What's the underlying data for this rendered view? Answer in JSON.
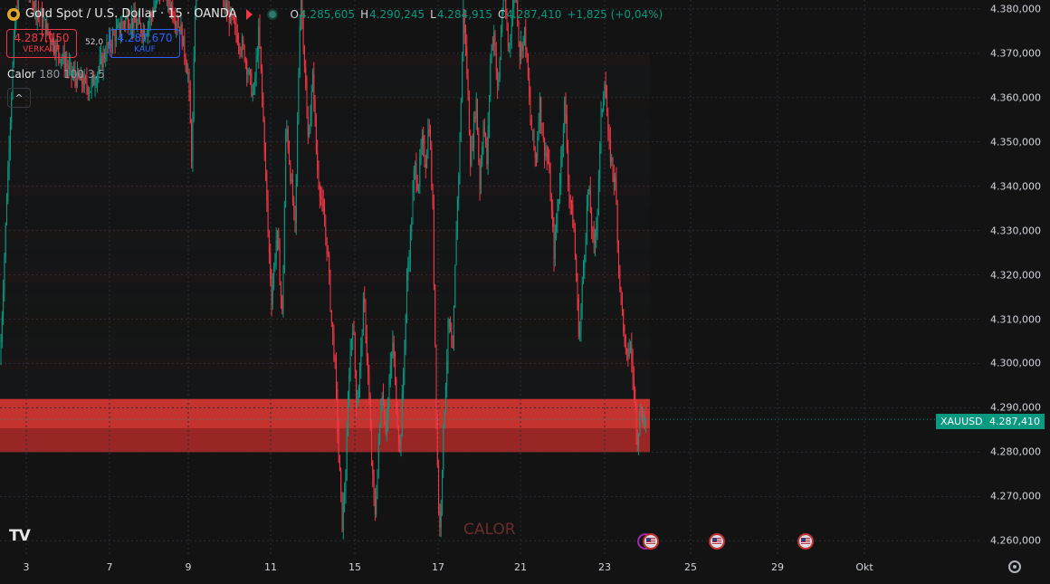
{
  "header": {
    "symbol_title": "Gold Spot / U.S. Dollar · 15 · OANDA",
    "ohlc": {
      "o_label": "O",
      "o_value": "4.285,605",
      "h_label": "H",
      "h_value": "4.290,245",
      "l_label": "L",
      "l_value": "4.284,915",
      "c_label": "C",
      "c_value": "4.287,410",
      "change": "+1,825 (+0,04%)"
    }
  },
  "trade": {
    "bid_price": "4.287,150",
    "bid_label": "VERKAUF",
    "spread": "52,0",
    "ask_price": "4.287,670",
    "ask_label": "KAUF"
  },
  "indicator": {
    "name": "Calor",
    "params": "180 100 3,5",
    "collapse_glyph": "^"
  },
  "watermark": "CALOR",
  "logo_text": "TV",
  "price_tag": {
    "symbol": "XAUUSD",
    "price": "4.287,410"
  },
  "colors": {
    "up": "#089981",
    "down": "#f23645",
    "zone": "#e53935",
    "background": "#131313"
  },
  "icons": [
    "gold-coin-icon",
    "flag-icon",
    "market-status-dot-icon",
    "chevron-up-icon",
    "us-flag-event-icon",
    "settings-gear-icon"
  ],
  "chart_data": {
    "type": "candlestick",
    "symbol": "XAUUSD",
    "y_ticks": [
      "4.260,000",
      "4.270,000",
      "4.280,000",
      "4.290,000",
      "4.300,000",
      "4.310,000",
      "4.320,000",
      "4.330,000",
      "4.340,000",
      "4.350,000",
      "4.360,000",
      "4.370,000",
      "4.380,000"
    ],
    "x_ticks": [
      "3",
      "7",
      "9",
      "11",
      "15",
      "17",
      "21",
      "23",
      "25",
      "29",
      "Okt"
    ],
    "ylim": [
      4257,
      4382
    ],
    "last_price": 4287.41,
    "zone": {
      "from": 4280,
      "to": 4292
    },
    "grid": true,
    "path": [
      [
        0,
        4300
      ],
      [
        6,
        4330
      ],
      [
        10,
        4350
      ],
      [
        16,
        4375
      ],
      [
        24,
        4390
      ],
      [
        40,
        4380
      ],
      [
        60,
        4372
      ],
      [
        80,
        4365
      ],
      [
        100,
        4362
      ],
      [
        120,
        4372
      ],
      [
        140,
        4378
      ],
      [
        160,
        4375
      ],
      [
        180,
        4385
      ],
      [
        200,
        4375
      ],
      [
        208,
        4365
      ],
      [
        212,
        4345
      ],
      [
        216,
        4385
      ],
      [
        232,
        4390
      ],
      [
        250,
        4380
      ],
      [
        270,
        4370
      ],
      [
        280,
        4360
      ],
      [
        286,
        4375
      ],
      [
        292,
        4350
      ],
      [
        296,
        4330
      ],
      [
        300,
        4315
      ],
      [
        306,
        4330
      ],
      [
        312,
        4310
      ],
      [
        316,
        4355
      ],
      [
        320,
        4345
      ],
      [
        326,
        4330
      ],
      [
        332,
        4385
      ],
      [
        336,
        4370
      ],
      [
        340,
        4350
      ],
      [
        346,
        4365
      ],
      [
        350,
        4345
      ],
      [
        356,
        4335
      ],
      [
        362,
        4325
      ],
      [
        366,
        4310
      ],
      [
        370,
        4300
      ],
      [
        374,
        4280
      ],
      [
        378,
        4264
      ],
      [
        382,
        4275
      ],
      [
        386,
        4300
      ],
      [
        390,
        4310
      ],
      [
        394,
        4290
      ],
      [
        398,
        4300
      ],
      [
        402,
        4315
      ],
      [
        406,
        4300
      ],
      [
        410,
        4280
      ],
      [
        414,
        4265
      ],
      [
        418,
        4280
      ],
      [
        422,
        4295
      ],
      [
        426,
        4285
      ],
      [
        430,
        4295
      ],
      [
        434,
        4305
      ],
      [
        438,
        4290
      ],
      [
        442,
        4280
      ],
      [
        446,
        4300
      ],
      [
        450,
        4320
      ],
      [
        454,
        4330
      ],
      [
        458,
        4345
      ],
      [
        462,
        4340
      ],
      [
        466,
        4350
      ],
      [
        470,
        4345
      ],
      [
        474,
        4355
      ],
      [
        478,
        4335
      ],
      [
        482,
        4290
      ],
      [
        484,
        4270
      ],
      [
        486,
        4262
      ],
      [
        488,
        4275
      ],
      [
        492,
        4295
      ],
      [
        496,
        4310
      ],
      [
        500,
        4300
      ],
      [
        504,
        4330
      ],
      [
        508,
        4350
      ],
      [
        512,
        4380
      ],
      [
        516,
        4365
      ],
      [
        520,
        4345
      ],
      [
        526,
        4360
      ],
      [
        530,
        4340
      ],
      [
        534,
        4355
      ],
      [
        538,
        4345
      ],
      [
        542,
        4370
      ],
      [
        546,
        4375
      ],
      [
        550,
        4360
      ],
      [
        556,
        4385
      ],
      [
        562,
        4370
      ],
      [
        566,
        4380
      ],
      [
        570,
        4385
      ],
      [
        574,
        4370
      ],
      [
        580,
        4375
      ],
      [
        586,
        4355
      ],
      [
        592,
        4345
      ],
      [
        596,
        4360
      ],
      [
        600,
        4350
      ],
      [
        606,
        4345
      ],
      [
        612,
        4325
      ],
      [
        618,
        4340
      ],
      [
        624,
        4360
      ],
      [
        628,
        4340
      ],
      [
        634,
        4330
      ],
      [
        640,
        4305
      ],
      [
        644,
        4320
      ],
      [
        650,
        4340
      ],
      [
        656,
        4325
      ],
      [
        660,
        4335
      ],
      [
        664,
        4355
      ],
      [
        668,
        4365
      ],
      [
        672,
        4350
      ],
      [
        676,
        4345
      ],
      [
        680,
        4340
      ],
      [
        684,
        4320
      ],
      [
        688,
        4310
      ],
      [
        692,
        4300
      ],
      [
        696,
        4305
      ],
      [
        700,
        4295
      ],
      [
        704,
        4283
      ],
      [
        708,
        4290
      ],
      [
        712,
        4287
      ]
    ]
  }
}
